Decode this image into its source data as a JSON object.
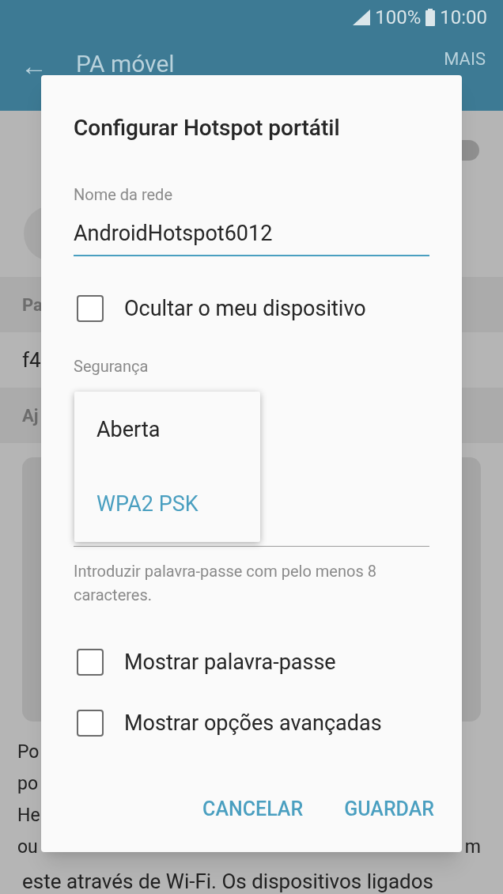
{
  "status_bar": {
    "battery": "100%",
    "time": "10:00"
  },
  "app_bar": {
    "back": "←",
    "title": "PA móvel",
    "more": "MAIS"
  },
  "background_rows": [
    {
      "kind": "switch",
      "on": false
    },
    {
      "kind": "icon"
    },
    {
      "kind": "header",
      "text": "Pa"
    },
    {
      "kind": "item",
      "text": "f4"
    },
    {
      "kind": "header",
      "text": "Aj"
    },
    {
      "kind": "card"
    },
    {
      "kind": "line",
      "text": "Po"
    },
    {
      "kind": "line",
      "text": "po"
    },
    {
      "kind": "line",
      "text": "He"
    },
    {
      "kind": "line",
      "text": "ou",
      "right": "m"
    },
    {
      "kind": "full",
      "text": "este através de Wi-Fi. Os dispositivos ligados"
    }
  ],
  "dialog": {
    "title": "Configurar Hotspot portátil",
    "network_name": {
      "label": "Nome da rede",
      "value": "AndroidHotspot6012"
    },
    "hide_device": {
      "label": "Ocultar o meu dispositivo",
      "checked": false
    },
    "security": {
      "label": "Segurança",
      "options": [
        {
          "label": "Aberta",
          "selected": false
        },
        {
          "label": "WPA2 PSK",
          "selected": true
        }
      ]
    },
    "password_hint": "Introduzir palavra-passe com pelo menos 8 caracteres.",
    "options": [
      {
        "label": "Mostrar palavra-passe",
        "checked": false
      },
      {
        "label": "Mostrar opções avançadas",
        "checked": false
      }
    ],
    "buttons": [
      "CANCELAR",
      "GUARDAR"
    ]
  }
}
